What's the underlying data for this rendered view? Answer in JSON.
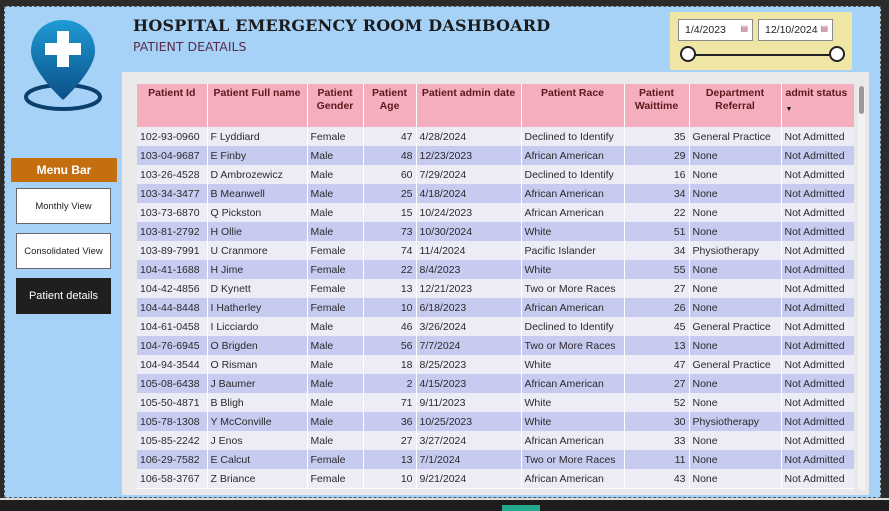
{
  "header": {
    "title": "HOSPITAL EMERGENCY ROOM DASHBOARD",
    "subtitle": "PATIENT DEATAILS"
  },
  "date_slicer": {
    "start_date": "1/4/2023",
    "end_date": "12/10/2024"
  },
  "menu": {
    "header": "Menu Bar",
    "items": [
      {
        "label": "Monthly View"
      },
      {
        "label": "Consolidated View"
      },
      {
        "label": "Patient details"
      }
    ]
  },
  "table": {
    "columns": [
      "Patient Id",
      "Patient Full name",
      "Patient Gender",
      "Patient Age",
      "Patient admin date",
      "Patient Race",
      "Patient Waittime",
      "Department Referral",
      "admit status"
    ],
    "rows": [
      [
        "102-93-0960",
        "F Lyddiard",
        "Female",
        "47",
        "4/28/2024",
        "Declined to Identify",
        "35",
        "General Practice",
        "Not Admitted"
      ],
      [
        "103-04-9687",
        "E Finby",
        "Male",
        "48",
        "12/23/2023",
        "African American",
        "29",
        "None",
        "Not Admitted"
      ],
      [
        "103-26-4528",
        "D Ambrozewicz",
        "Male",
        "60",
        "7/29/2024",
        "Declined to Identify",
        "16",
        "None",
        "Not Admitted"
      ],
      [
        "103-34-3477",
        "B Meanwell",
        "Male",
        "25",
        "4/18/2024",
        "African American",
        "34",
        "None",
        "Not Admitted"
      ],
      [
        "103-73-6870",
        "Q Pickston",
        "Male",
        "15",
        "10/24/2023",
        "African American",
        "22",
        "None",
        "Not Admitted"
      ],
      [
        "103-81-2792",
        "H Ollie",
        "Male",
        "73",
        "10/30/2024",
        "White",
        "51",
        "None",
        "Not Admitted"
      ],
      [
        "103-89-7991",
        "U Cranmore",
        "Female",
        "74",
        "11/4/2024",
        "Pacific Islander",
        "34",
        "Physiotherapy",
        "Not Admitted"
      ],
      [
        "104-41-1688",
        "H Jime",
        "Female",
        "22",
        "8/4/2023",
        "White",
        "55",
        "None",
        "Not Admitted"
      ],
      [
        "104-42-4856",
        "D Kynett",
        "Female",
        "13",
        "12/21/2023",
        "Two or More Races",
        "27",
        "None",
        "Not Admitted"
      ],
      [
        "104-44-8448",
        "I Hatherley",
        "Female",
        "10",
        "6/18/2023",
        "African American",
        "26",
        "None",
        "Not Admitted"
      ],
      [
        "104-61-0458",
        "I Licciardo",
        "Male",
        "46",
        "3/26/2024",
        "Declined to Identify",
        "45",
        "General Practice",
        "Not Admitted"
      ],
      [
        "104-76-6945",
        "O Brigden",
        "Male",
        "56",
        "7/7/2024",
        "Two or More Races",
        "13",
        "None",
        "Not Admitted"
      ],
      [
        "104-94-3544",
        "O Risman",
        "Male",
        "18",
        "8/25/2023",
        "White",
        "47",
        "General Practice",
        "Not Admitted"
      ],
      [
        "105-08-6438",
        "J Baumer",
        "Male",
        "2",
        "4/15/2023",
        "African American",
        "27",
        "None",
        "Not Admitted"
      ],
      [
        "105-50-4871",
        "B Bligh",
        "Male",
        "71",
        "9/11/2023",
        "White",
        "52",
        "None",
        "Not Admitted"
      ],
      [
        "105-78-1308",
        "Y McConville",
        "Male",
        "36",
        "10/25/2023",
        "White",
        "30",
        "Physiotherapy",
        "Not Admitted"
      ],
      [
        "105-85-2242",
        "J Enos",
        "Male",
        "27",
        "3/27/2024",
        "African American",
        "33",
        "None",
        "Not Admitted"
      ],
      [
        "106-29-7582",
        "E Calcut",
        "Female",
        "13",
        "7/1/2024",
        "Two or More Races",
        "11",
        "None",
        "Not Admitted"
      ],
      [
        "106-58-3767",
        "Z Briance",
        "Female",
        "10",
        "9/21/2024",
        "African American",
        "43",
        "None",
        "Not Admitted"
      ]
    ]
  }
}
